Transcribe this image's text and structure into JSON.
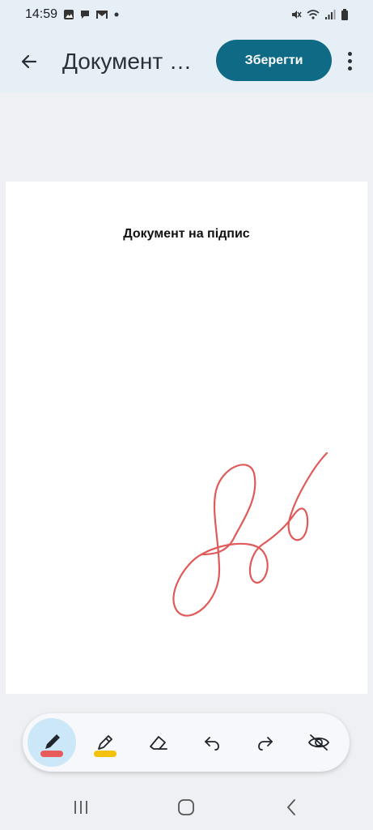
{
  "status_bar": {
    "time": "14:59",
    "left_icons": [
      "gallery-icon",
      "chat-icon",
      "gmail-icon",
      "dot-icon"
    ],
    "right_icons": [
      "mute-icon",
      "wifi-icon",
      "signal-icon",
      "battery-icon"
    ]
  },
  "app_bar": {
    "title": "Документ на підпис",
    "save_label": "Зберегти"
  },
  "document": {
    "heading": "Документ на підпис"
  },
  "toolbar": {
    "tools": [
      {
        "name": "pen",
        "icon": "pen-icon",
        "active": true,
        "color": "#e85b5b"
      },
      {
        "name": "highlighter",
        "icon": "highlighter-icon",
        "active": false,
        "color": "#f4c20d"
      },
      {
        "name": "eraser",
        "icon": "eraser-icon",
        "active": false
      },
      {
        "name": "undo",
        "icon": "undo-icon",
        "active": false
      },
      {
        "name": "redo",
        "icon": "redo-icon",
        "active": false
      },
      {
        "name": "hide",
        "icon": "eye-off-icon",
        "active": false
      }
    ]
  },
  "colors": {
    "accent": "#0f6a86",
    "signature": "#e05a5a",
    "active_tool_bg": "#cce7f8"
  }
}
